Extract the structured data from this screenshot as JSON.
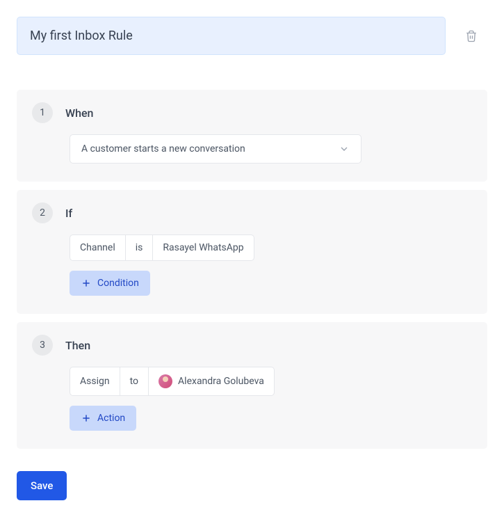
{
  "rule_name": "My first Inbox Rule",
  "steps": {
    "when": {
      "number": "1",
      "title": "When",
      "trigger": "A customer starts a new conversation"
    },
    "if": {
      "number": "2",
      "title": "If",
      "condition": {
        "field": "Channel",
        "operator": "is",
        "value": "Rasayel WhatsApp"
      },
      "add_label": "Condition"
    },
    "then": {
      "number": "3",
      "title": "Then",
      "action": {
        "type": "Assign",
        "operator": "to",
        "target": "Alexandra Golubeva"
      },
      "add_label": "Action"
    }
  },
  "save_label": "Save"
}
